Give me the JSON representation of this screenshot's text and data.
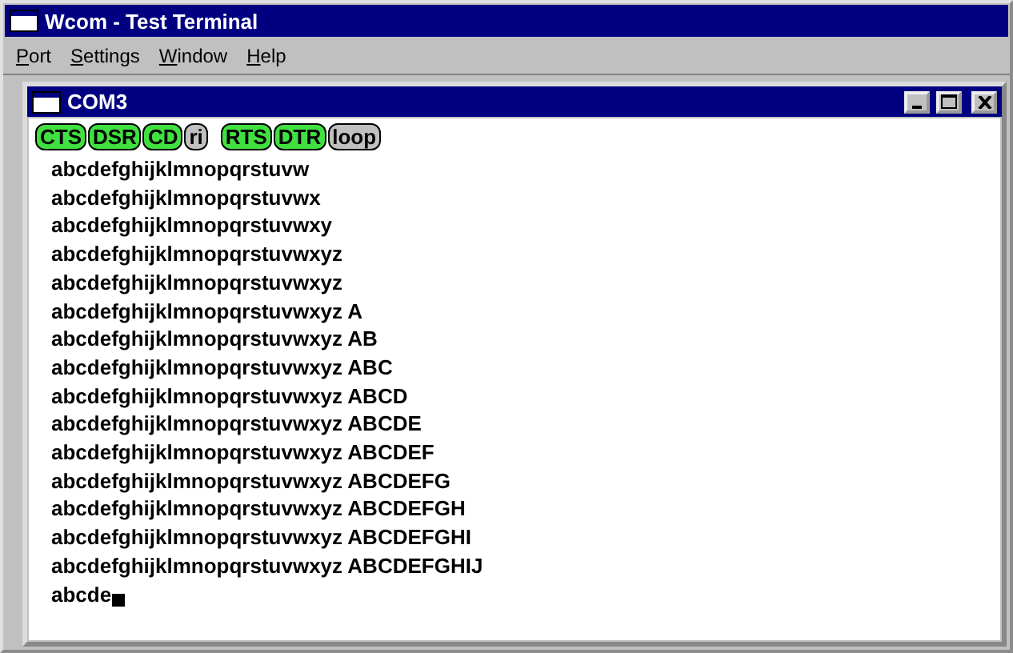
{
  "window": {
    "title": "Wcom - Test Terminal"
  },
  "menu": [
    "Port",
    "Settings",
    "Window",
    "Help"
  ],
  "child_window": {
    "title": "COM3",
    "signal_groups": [
      [
        {
          "label": "CTS",
          "on": true
        },
        {
          "label": "DSR",
          "on": true
        },
        {
          "label": "CD",
          "on": true
        },
        {
          "label": "ri",
          "on": false
        }
      ],
      [
        {
          "label": "RTS",
          "on": true
        },
        {
          "label": "DTR",
          "on": true
        },
        {
          "label": "loop",
          "on": false
        }
      ]
    ],
    "lines": [
      "abcdefghijklmnopqrstuvw",
      "abcdefghijklmnopqrstuvwx",
      "abcdefghijklmnopqrstuvwxy",
      "abcdefghijklmnopqrstuvwxyz",
      "abcdefghijklmnopqrstuvwxyz",
      "abcdefghijklmnopqrstuvwxyz A",
      "abcdefghijklmnopqrstuvwxyz AB",
      "abcdefghijklmnopqrstuvwxyz ABC",
      "abcdefghijklmnopqrstuvwxyz ABCD",
      "abcdefghijklmnopqrstuvwxyz ABCDE",
      "abcdefghijklmnopqrstuvwxyz ABCDEF",
      "abcdefghijklmnopqrstuvwxyz ABCDEFG",
      "abcdefghijklmnopqrstuvwxyz ABCDEFGH",
      "abcdefghijklmnopqrstuvwxyz ABCDEFGHI",
      "abcdefghijklmnopqrstuvwxyz ABCDEFGHIJ"
    ],
    "input_line": "abcde"
  }
}
